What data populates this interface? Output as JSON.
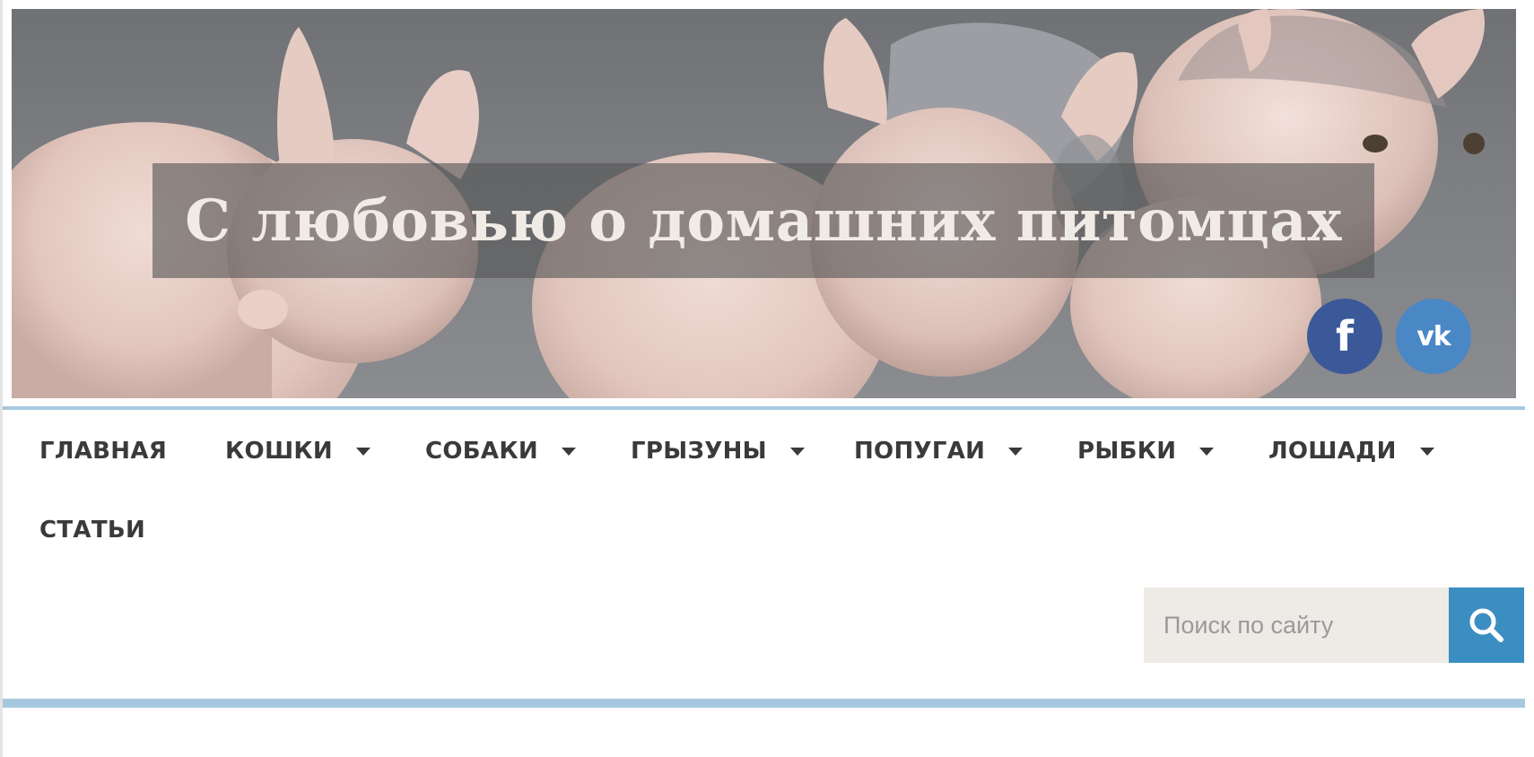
{
  "header": {
    "site_title": "С любовью о домашних питомцах",
    "social": [
      {
        "name": "facebook",
        "glyph": "f",
        "color": "#3b5998"
      },
      {
        "name": "vkontakte",
        "glyph": "vk",
        "color": "#4a87c5"
      }
    ]
  },
  "nav": {
    "items": [
      {
        "label": "ГЛАВНАЯ",
        "has_submenu": false
      },
      {
        "label": "КОШКИ",
        "has_submenu": true
      },
      {
        "label": "СОБАКИ",
        "has_submenu": true
      },
      {
        "label": "ГРЫЗУНЫ",
        "has_submenu": true
      },
      {
        "label": "ПОПУГАИ",
        "has_submenu": true
      },
      {
        "label": "РЫБКИ",
        "has_submenu": true
      },
      {
        "label": "ЛОШАДИ",
        "has_submenu": true
      },
      {
        "label": "СТАТЬИ",
        "has_submenu": false
      }
    ]
  },
  "search": {
    "placeholder": "Поиск по сайту",
    "value": "",
    "button_icon": "search-icon"
  },
  "colors": {
    "accent_line": "#a6c8df",
    "search_button": "#3b8ec2",
    "nav_text": "#3a3a3a",
    "search_field_bg": "#eeebe6"
  }
}
